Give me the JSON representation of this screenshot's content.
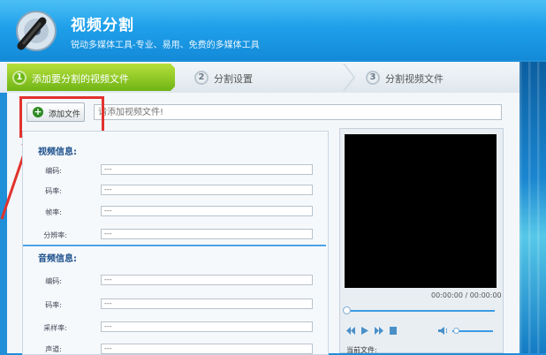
{
  "app": {
    "title": "视频分割",
    "subtitle": "锐动多媒体工具-专业、易用、免费的多媒体工具"
  },
  "steps": [
    {
      "num": "1",
      "label": "添加要分割的视频文件",
      "active": true
    },
    {
      "num": "2",
      "label": "分割设置",
      "active": false
    },
    {
      "num": "3",
      "label": "分割视频文件",
      "active": false
    }
  ],
  "toolbar": {
    "add_file_label": "添加文件",
    "path_placeholder": "请添加视频文件!"
  },
  "video_info": {
    "title": "视频信息:",
    "fields": [
      {
        "label": "编码:",
        "value": "---"
      },
      {
        "label": "码率:",
        "value": "---"
      },
      {
        "label": "帧率:",
        "value": "---"
      },
      {
        "label": "分辨率:",
        "value": "---"
      }
    ]
  },
  "audio_info": {
    "title": "音频信息:",
    "fields": [
      {
        "label": "编码:",
        "value": "---"
      },
      {
        "label": "码率:",
        "value": "---"
      },
      {
        "label": "采样率:",
        "value": "---"
      },
      {
        "label": "声道:",
        "value": "---"
      }
    ]
  },
  "player": {
    "time": "00:00:00 / 00:00:00",
    "current_file_label": "当前文件:",
    "seek_position": 0,
    "volume_level": 0.1
  },
  "colors": {
    "header": "#1fa0ea",
    "active_step": "#6fb416",
    "highlight": "#e2322d",
    "section_title": "#1a4f8a"
  }
}
